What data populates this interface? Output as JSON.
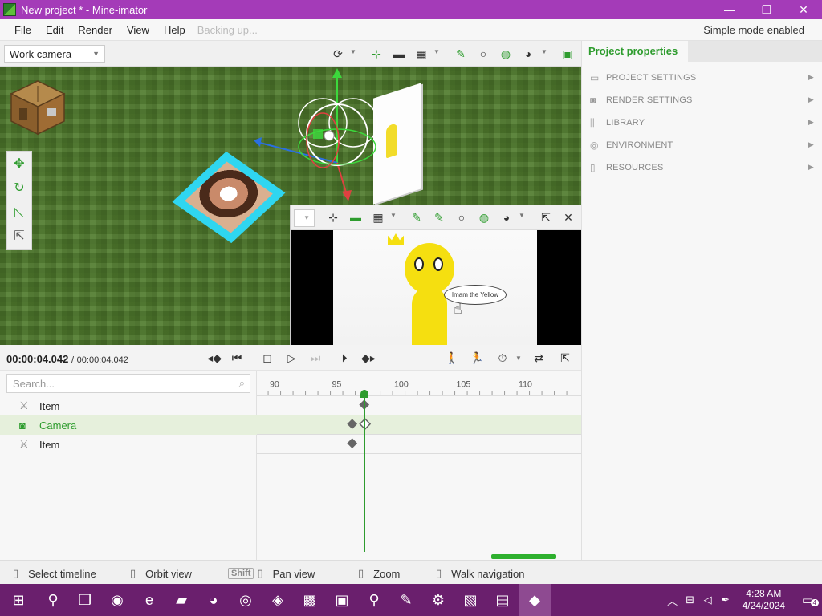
{
  "window": {
    "title": "New project * - Mine-imator",
    "minimize_icon": "—",
    "maximize_icon": "❐",
    "close_icon": "✕"
  },
  "menu": {
    "items": [
      "File",
      "Edit",
      "Render",
      "View",
      "Help"
    ],
    "status": "Backing up...",
    "mode": "Simple mode enabled"
  },
  "viewport": {
    "camera": "Work camera"
  },
  "preview": {
    "bubble_text": "Imam the Yellow"
  },
  "properties": {
    "tab": "Project properties",
    "sections": [
      {
        "label": "PROJECT SETTINGS",
        "icon": "folder-icon"
      },
      {
        "label": "RENDER SETTINGS",
        "icon": "camera-icon"
      },
      {
        "label": "LIBRARY",
        "icon": "library-icon"
      },
      {
        "label": "ENVIRONMENT",
        "icon": "globe-icon"
      },
      {
        "label": "RESOURCES",
        "icon": "document-icon"
      }
    ]
  },
  "playback": {
    "current_time": "00:00:04.042",
    "separator": "/",
    "total_time": "00:00:04.042"
  },
  "timeline": {
    "search_placeholder": "Search...",
    "rows": [
      {
        "label": "Item",
        "selected": false
      },
      {
        "label": "Camera",
        "selected": true
      },
      {
        "label": "Item",
        "selected": false
      }
    ],
    "ruler_labels": [
      "90",
      "95",
      "100",
      "105",
      "110"
    ],
    "playhead_frame": 97
  },
  "statusbar": {
    "items": [
      {
        "label": "Select timeline"
      },
      {
        "label": "Orbit view"
      },
      {
        "key": "Shift",
        "label": "Pan view"
      },
      {
        "label": "Zoom"
      },
      {
        "label": "Walk navigation"
      }
    ]
  },
  "taskbar": {
    "time": "4:28 AM",
    "date": "4/24/2024",
    "notification_count": "4"
  },
  "colors": {
    "accent_green": "#2e9c2e",
    "titlebar_purple": "#a43bb8",
    "taskbar_purple": "#6a1f6d",
    "grass": "#4f7a2c"
  }
}
